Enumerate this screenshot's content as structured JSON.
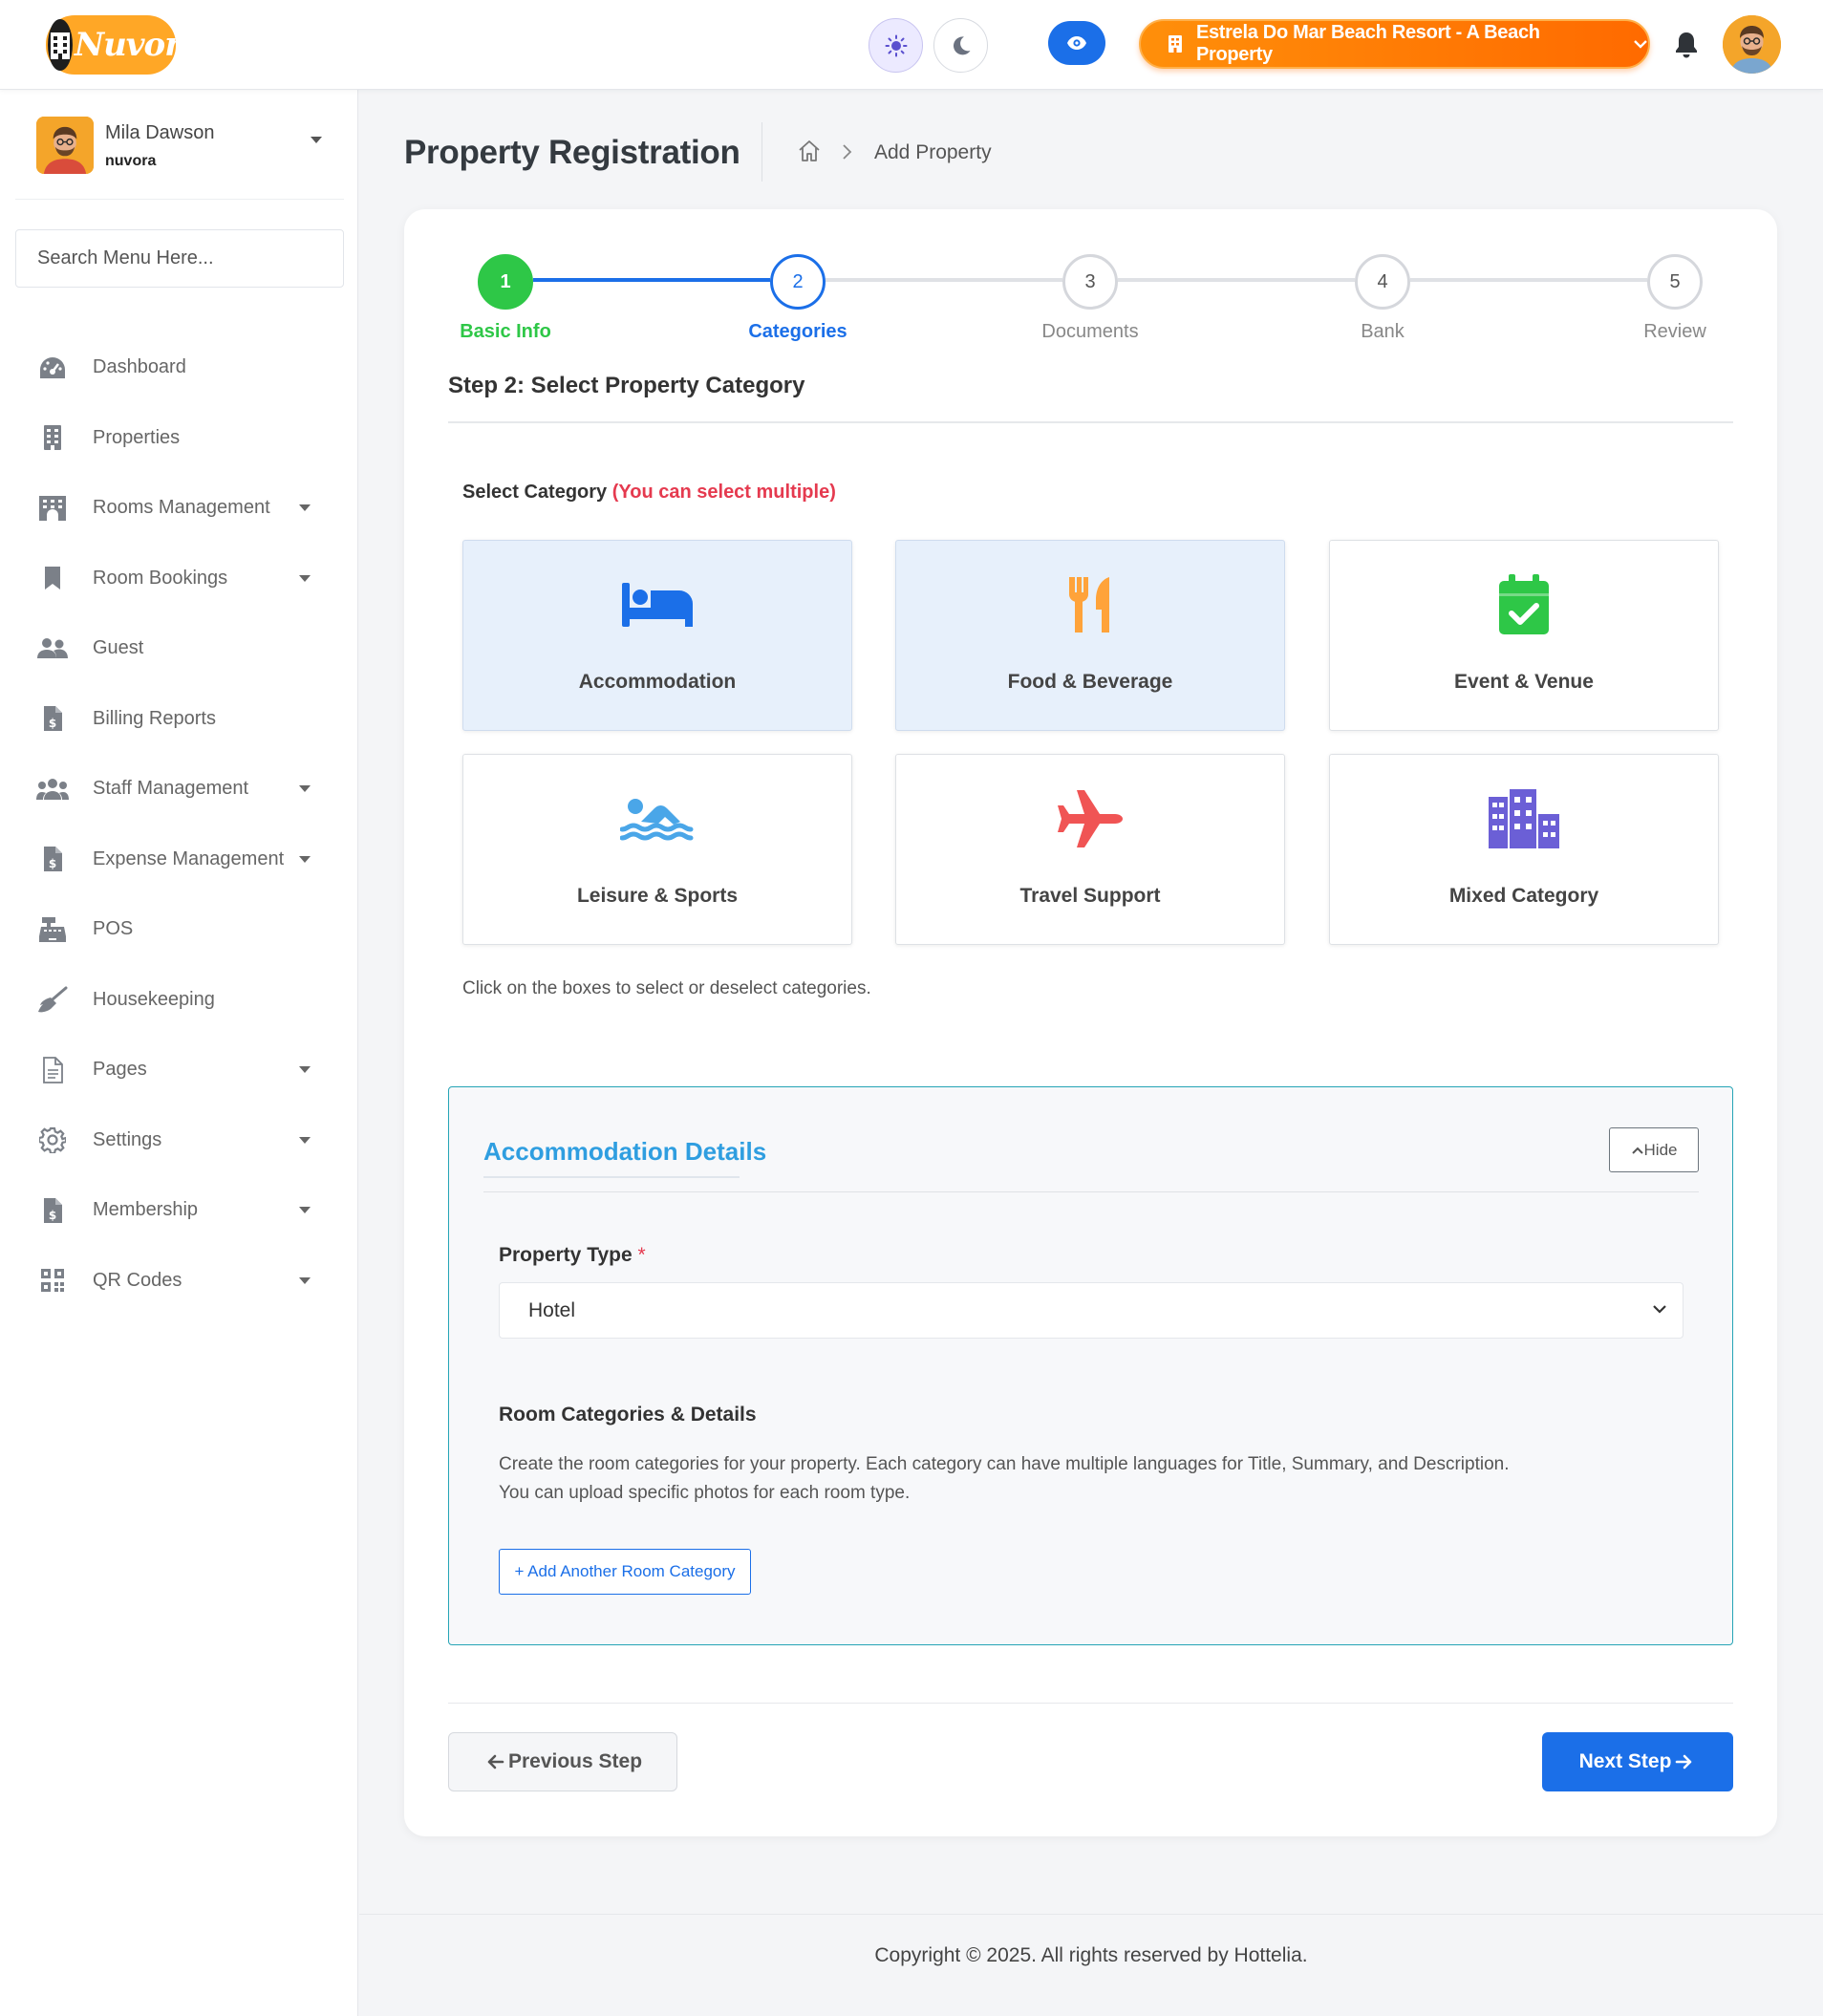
{
  "header": {
    "logo_text": "Nuvora",
    "property_name": "Estrela Do Mar Beach Resort - A Beach Property"
  },
  "sidebar": {
    "user_name": "Mila Dawson",
    "user_org": "nuvora",
    "search_placeholder": "Search Menu Here...",
    "items": [
      {
        "label": "Dashboard",
        "icon": "dashboard-icon",
        "caret": false
      },
      {
        "label": "Properties",
        "icon": "building-icon",
        "caret": false
      },
      {
        "label": "Rooms Management",
        "icon": "hotel-icon",
        "caret": true
      },
      {
        "label": "Room Bookings",
        "icon": "bookmark-icon",
        "caret": true
      },
      {
        "label": "Guest",
        "icon": "users-icon",
        "caret": false
      },
      {
        "label": "Billing Reports",
        "icon": "invoice-icon",
        "caret": false
      },
      {
        "label": "Staff Management",
        "icon": "team-icon",
        "caret": true
      },
      {
        "label": "Expense Management",
        "icon": "invoice-icon",
        "caret": true
      },
      {
        "label": "POS",
        "icon": "cash-register-icon",
        "caret": false
      },
      {
        "label": "Housekeeping",
        "icon": "broom-icon",
        "caret": false
      },
      {
        "label": "Pages",
        "icon": "file-icon",
        "caret": true
      },
      {
        "label": "Settings",
        "icon": "gear-icon",
        "caret": true
      },
      {
        "label": "Membership",
        "icon": "invoice-icon",
        "caret": true
      },
      {
        "label": "QR Codes",
        "icon": "qr-code-icon",
        "caret": true
      }
    ]
  },
  "page": {
    "title": "Property Registration",
    "breadcrumb": "Add Property"
  },
  "stepper": {
    "steps": [
      {
        "number": "1",
        "label": "Basic Info",
        "state": "done"
      },
      {
        "number": "2",
        "label": "Categories",
        "state": "active"
      },
      {
        "number": "3",
        "label": "Documents",
        "state": "pending"
      },
      {
        "number": "4",
        "label": "Bank",
        "state": "pending"
      },
      {
        "number": "5",
        "label": "Review",
        "state": "pending"
      }
    ]
  },
  "step": {
    "heading": "Step 2: Select Property Category",
    "select_label": "Select Category",
    "select_hint": "(You can select multiple)",
    "note": "Click on the boxes to select or deselect categories.",
    "categories": [
      {
        "label": "Accommodation",
        "icon": "bed-icon",
        "selected": true,
        "color": "#1b6fe8"
      },
      {
        "label": "Food & Beverage",
        "icon": "utensils-icon",
        "selected": true,
        "color": "#ffa33a"
      },
      {
        "label": "Event & Venue",
        "icon": "calendar-check-icon",
        "selected": false,
        "color": "#2ec747"
      },
      {
        "label": "Leisure & Sports",
        "icon": "swimmer-icon",
        "selected": false,
        "color": "#4aa6e8"
      },
      {
        "label": "Travel Support",
        "icon": "plane-icon",
        "selected": false,
        "color": "#f05454"
      },
      {
        "label": "Mixed Category",
        "icon": "city-icon",
        "selected": false,
        "color": "#6b5fd6"
      }
    ]
  },
  "accommodation": {
    "title": "Accommodation Details",
    "hide_label": "Hide",
    "property_type_label": "Property Type",
    "required_mark": "*",
    "property_type_value": "Hotel",
    "room_categories_title": "Room Categories & Details",
    "room_categories_desc_1": "Create the room categories for your property. Each category can have multiple languages for Title, Summary, and Description.",
    "room_categories_desc_2": "You can upload specific photos for each room type.",
    "add_button": "+ Add Another Room Category"
  },
  "nav": {
    "previous": "Previous Step",
    "next": "Next Step"
  },
  "footer": {
    "copyright": "Copyright © 2025. All rights reserved by Hottelia."
  },
  "colors": {
    "primary": "#1b6fe8",
    "success": "#2ec747",
    "accent_orange": "#ff7a00",
    "danger": "#e53a4f",
    "panel_border": "#26a4b6"
  }
}
